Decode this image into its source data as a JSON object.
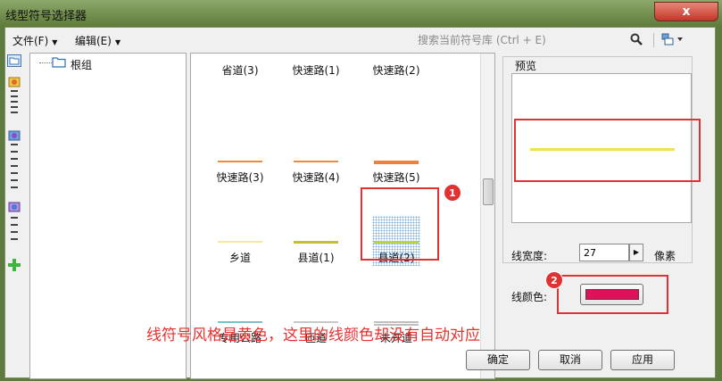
{
  "window": {
    "title": "线型符号选择器",
    "close_glyph": "x"
  },
  "menu": {
    "file_label": "文件(F)",
    "edit_label": "编辑(E)",
    "search_placeholder": "搜索当前符号库 (Ctrl + E)",
    "icons": [
      "search-icon",
      "view-options-icon"
    ]
  },
  "left_strip": {
    "icons": [
      "folder-icon",
      "style-library-icon-1",
      "style-library-icon-2",
      "style-library-icon-3",
      "add-icon"
    ]
  },
  "tree": {
    "root_label": "根组"
  },
  "symbols": [
    {
      "label": "省道(3)",
      "color": "#f3d57a"
    },
    {
      "label": "快速路(1)",
      "color": "#f3d57a"
    },
    {
      "label": "快速路(2)",
      "color": "#f3d57a"
    },
    {
      "label": "快速路(3)",
      "color": "#f08a35"
    },
    {
      "label": "快速路(4)",
      "color": "#f08a35"
    },
    {
      "label": "快速路(5)",
      "color": "#ef7f3a"
    },
    {
      "label": "乡道",
      "color": "#f5e6a0"
    },
    {
      "label": "县道(1)",
      "color": "#c4bf35"
    },
    {
      "label": "县道(2)",
      "color": "#b8d24a"
    },
    {
      "label": "专用公路",
      "color": "#7ac0c8"
    },
    {
      "label": "匝道",
      "color": "#c8c8c8"
    },
    {
      "label": "未开道",
      "color": "#bfbfbf"
    }
  ],
  "preview": {
    "title": "预览",
    "line_color": "#f0e24a"
  },
  "properties": {
    "width_label": "线宽度:",
    "width_value": "27",
    "width_unit": "像素",
    "color_label": "线颜色:",
    "color_value": "#e0105a"
  },
  "buttons": {
    "ok": "确定",
    "cancel": "取消",
    "apply": "应用"
  },
  "annotations": {
    "badge_1": "1",
    "badge_2": "2",
    "caption": "线符号风格是黄色，这里的线颜色却没有自动对应",
    "color": "#e03232"
  }
}
